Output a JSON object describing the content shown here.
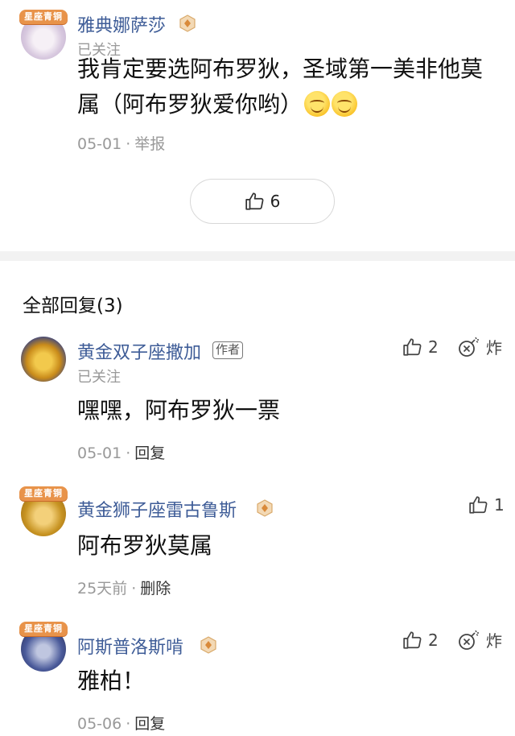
{
  "post": {
    "author": {
      "name": "雅典娜萨莎",
      "status": "已关注",
      "badge_text": "星座青铜"
    },
    "content_text": "我肯定要选阿布罗狄，圣域第一美非他莫属（阿布罗狄爱你哟）",
    "content_line1": "我肯定要选阿布罗狄，圣域第一美非他莫",
    "content_line2": "属（阿布罗狄爱你哟）",
    "date": "05-01",
    "action": "举报",
    "likes": "6"
  },
  "replies_header": "全部回复(3)",
  "replies": [
    {
      "name": "黄金双子座撒加",
      "author_tag": "作者",
      "status": "已关注",
      "content": "嘿嘿，阿布罗狄一票",
      "date": "05-01",
      "action": "回复",
      "likes": "2",
      "bomb_label": "炸"
    },
    {
      "name": "黄金狮子座雷古鲁斯",
      "badge_text": "星座青铜",
      "content": "阿布罗狄莫属",
      "date": "25天前",
      "action": "删除",
      "likes": "1"
    },
    {
      "name": "阿斯普洛斯啃",
      "badge_text": "星座青铜",
      "content": "雅柏！",
      "date": "05-06",
      "action": "回复",
      "likes": "2",
      "bomb_label": "炸"
    }
  ],
  "meta_separator": "·",
  "icons": {
    "like": "thumb-up-icon",
    "bomb": "bomb-icon",
    "level": "level-badge-icon",
    "emoji": "smile-emoji-icon"
  },
  "colors": {
    "username": "#3e5c97",
    "muted": "#999999",
    "badge_orange": "#e8934a"
  }
}
